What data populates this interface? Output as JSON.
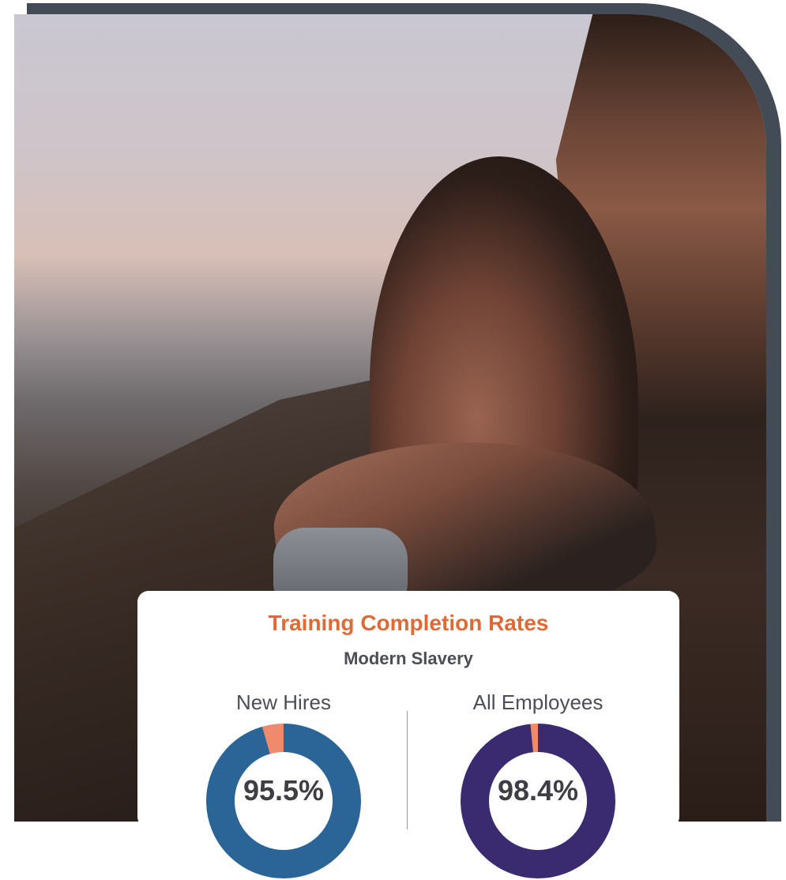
{
  "card": {
    "title": "Training Completion Rates",
    "subtitle": "Modern Slavery"
  },
  "colors": {
    "frame": "#434b57",
    "title": "#e06a36",
    "new_hires_ring": "#2b6598",
    "all_employees_ring": "#3a2b70",
    "remainder": "#ef8a6c"
  },
  "chart_data": [
    {
      "type": "pie",
      "title": "New Hires",
      "values": [
        95.5,
        4.5
      ],
      "label": "95.5%"
    },
    {
      "type": "pie",
      "title": "All Employees",
      "values": [
        98.4,
        1.6
      ],
      "label": "98.4%"
    }
  ]
}
